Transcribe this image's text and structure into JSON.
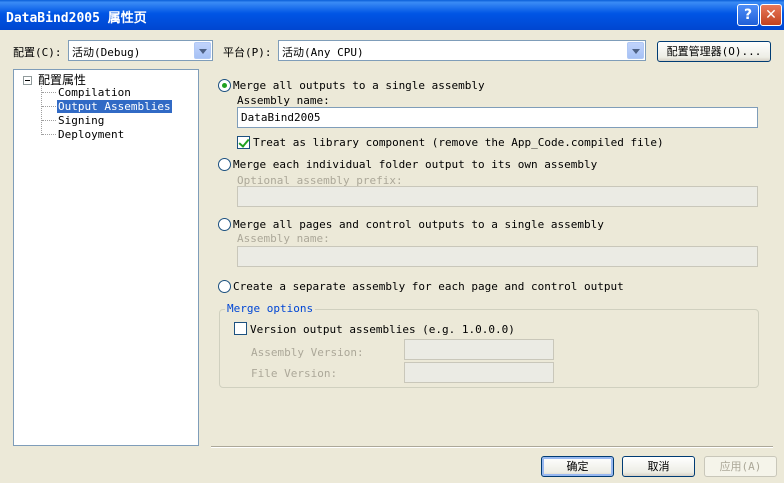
{
  "window": {
    "title": "DataBind2005 属性页",
    "help_glyph": "?",
    "close_glyph": "✕"
  },
  "toolbar": {
    "config_label": "配置(C):",
    "config_value": "活动(Debug)",
    "platform_label": "平台(P):",
    "platform_value": "活动(Any CPU)",
    "config_manager_label": "配置管理器(O)..."
  },
  "tree": {
    "root": "配置属性",
    "items": [
      "Compilation",
      "Output Assemblies",
      "Signing",
      "Deployment"
    ],
    "selected_index": 1
  },
  "options": {
    "merge_single": {
      "label": "Merge all outputs to a single assembly",
      "field_label": "Assembly name:",
      "field_value": "DataBind2005",
      "checked": true
    },
    "treat_library": {
      "label": "Treat as library component (remove the App_Code.compiled file)",
      "checked": true
    },
    "merge_each_folder": {
      "label": "Merge each individual folder output to its own assembly",
      "field_label": "Optional assembly prefix:",
      "field_value": "",
      "checked": false
    },
    "merge_pages": {
      "label": "Merge all pages and control outputs to a single assembly",
      "field_label": "Assembly name:",
      "field_value": "",
      "checked": false
    },
    "separate_assembly": {
      "label": "Create a separate assembly for each page and control output",
      "checked": false
    }
  },
  "merge_options": {
    "title": "Merge options",
    "version_output_label": "Version output assemblies (e.g. 1.0.0.0)",
    "version_output_checked": false,
    "assembly_version_label": "Assembly Version:",
    "assembly_version_value": "",
    "file_version_label": "File Version:",
    "file_version_value": ""
  },
  "buttons": {
    "ok": "确定",
    "cancel": "取消",
    "apply": "应用(A)"
  }
}
